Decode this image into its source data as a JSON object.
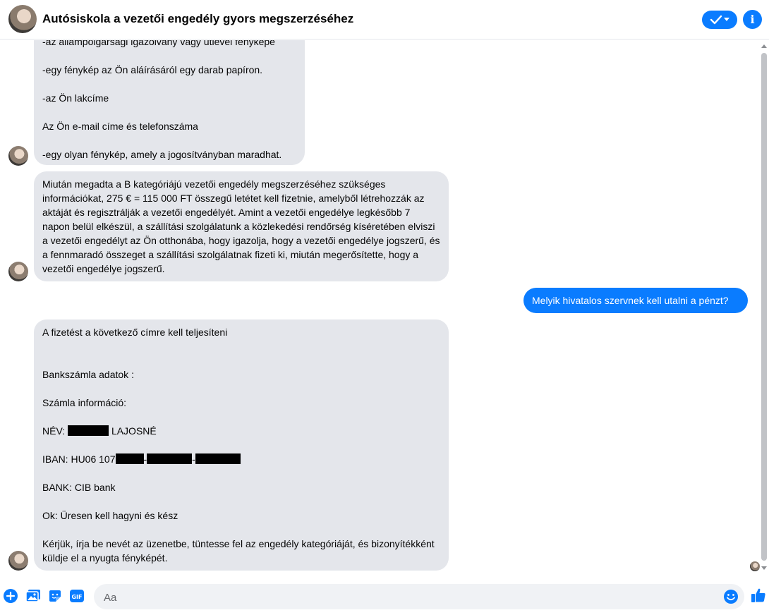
{
  "header": {
    "title": "Autósiskola a vezetői engedély gyors megszerzéséhez",
    "accent_color": "#0a7cff"
  },
  "messages": {
    "msg1": {
      "partial_line": "-az állampolgársági igazolvány vagy útlevél fényképe",
      "line2": "-egy fénykép az Ön aláírásáról egy darab papíron.",
      "line3": "-az Ön lakcíme",
      "line4": "Az Ön e-mail címe és telefonszáma",
      "line5": "-egy olyan fénykép, amely a jogosítványban maradhat."
    },
    "msg2": {
      "text": "Miután megadta a B kategóriájú vezetői engedély megszerzéséhez szükséges információkat, 275 € = 115 000 FT összegű letétet kell fizetnie, amelyből létrehozzák az aktáját és regisztrálják a vezetői engedélyét. Amint a vezetői engedélye legkésőbb 7 napon belül elkészül, a szállítási szolgálatunk a közlekedési rendőrség kíséretében elviszi a vezetői engedélyt az Ön otthonába, hogy igazolja, hogy a vezetői engedélye jogszerű, és a fennmaradó összeget a szállítási szolgálatnak fizeti ki, miután megerősítette, hogy a vezetői engedélye jogszerű."
    },
    "outgoing": {
      "text": "Melyik hivatalos szervnek kell utalni a pénzt?"
    },
    "msg3": {
      "line1": "A fizetést a következő címre kell teljesíteni",
      "line2": "Bankszámla adatok :",
      "line3": "Számla információ:",
      "name_prefix": "NÉV:",
      "name_suffix": "LAJOSNÉ",
      "iban_prefix": "IBAN: HU06 107",
      "bank": "BANK: CIB bank",
      "ok": "Ok: Üresen kell hagyni és kész",
      "closing": "Kérjük, írja be nevét az üzenetbe, tüntesse fel az engedély kategóriáját, és bizonyítékként küldje el a nyugta fényképét."
    }
  },
  "composer": {
    "placeholder": "Aa"
  }
}
